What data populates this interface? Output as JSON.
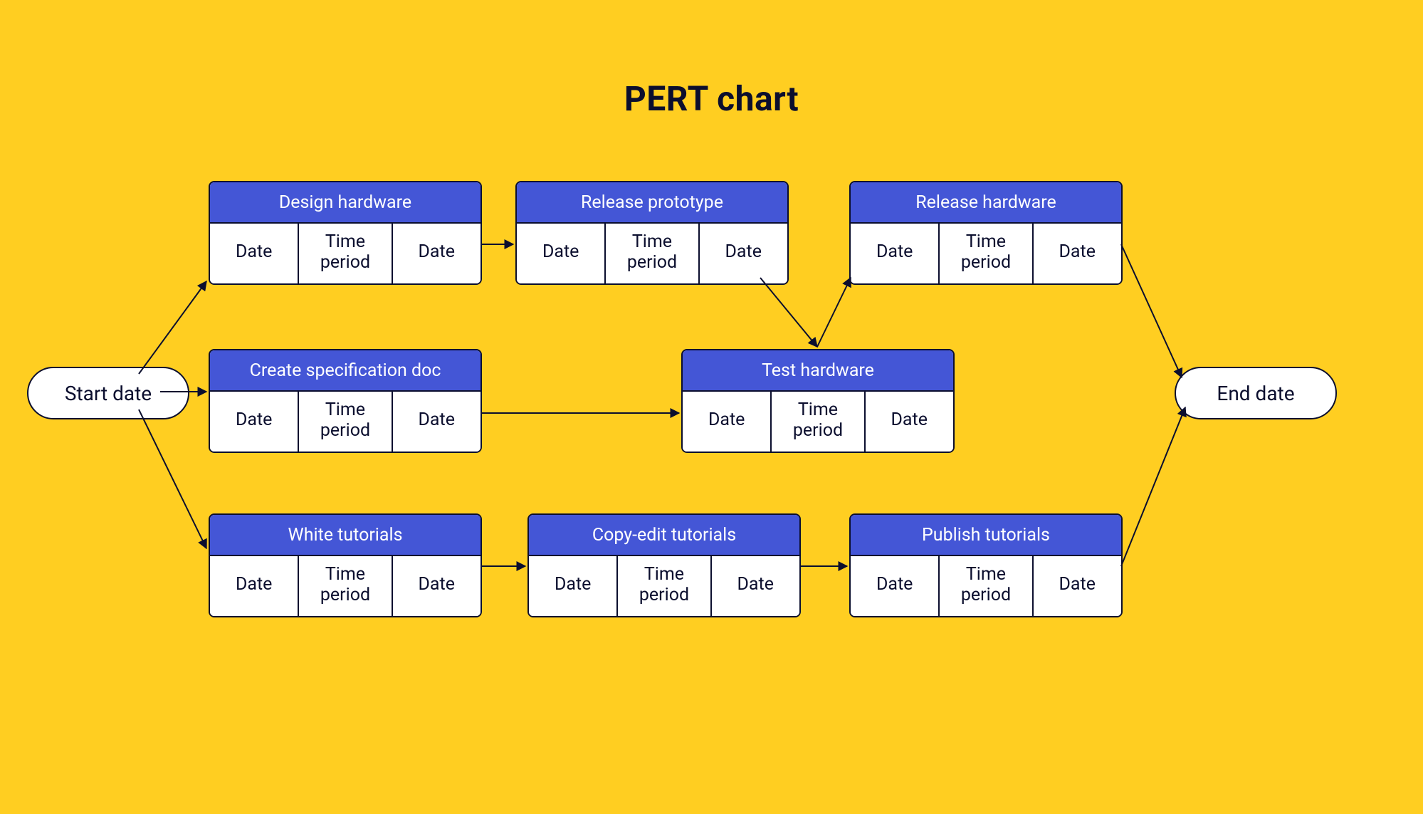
{
  "title": "PERT chart",
  "start": "Start date",
  "end": "End date",
  "cellLabels": {
    "date": "Date",
    "period": "Time period"
  },
  "tasks": {
    "designHardware": {
      "title": "Design hardware",
      "c1": "Date",
      "c2": "Time period",
      "c3": "Date"
    },
    "releasePrototype": {
      "title": "Release prototype",
      "c1": "Date",
      "c2": "Time period",
      "c3": "Date"
    },
    "releaseHardware": {
      "title": "Release hardware",
      "c1": "Date",
      "c2": "Time period",
      "c3": "Date"
    },
    "createSpec": {
      "title": "Create specification doc",
      "c1": "Date",
      "c2": "Time period",
      "c3": "Date"
    },
    "testHardware": {
      "title": "Test hardware",
      "c1": "Date",
      "c2": "Time period",
      "c3": "Date"
    },
    "whiteTutorials": {
      "title": "White tutorials",
      "c1": "Date",
      "c2": "Time period",
      "c3": "Date"
    },
    "copyEditTutorials": {
      "title": "Copy-edit tutorials",
      "c1": "Date",
      "c2": "Time period",
      "c3": "Date"
    },
    "publishTutorials": {
      "title": "Publish tutorials",
      "c1": "Date",
      "c2": "Time period",
      "c3": "Date"
    }
  },
  "edges": [
    {
      "from": "start",
      "to": "designHardware"
    },
    {
      "from": "start",
      "to": "createSpec"
    },
    {
      "from": "start",
      "to": "whiteTutorials"
    },
    {
      "from": "designHardware",
      "to": "releasePrototype"
    },
    {
      "from": "releasePrototype",
      "to": "testHardware"
    },
    {
      "from": "createSpec",
      "to": "testHardware"
    },
    {
      "from": "testHardware",
      "to": "releaseHardware"
    },
    {
      "from": "releaseHardware",
      "to": "end"
    },
    {
      "from": "whiteTutorials",
      "to": "copyEditTutorials"
    },
    {
      "from": "copyEditTutorials",
      "to": "publishTutorials"
    },
    {
      "from": "publishTutorials",
      "to": "end"
    }
  ]
}
